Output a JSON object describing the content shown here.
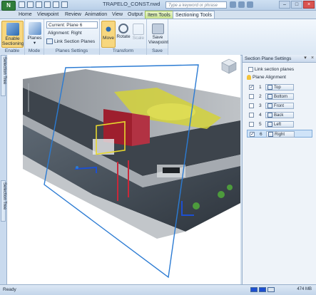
{
  "title_bar": {
    "app_button": "N",
    "document_title": "TRAPELO_CONST.nwd",
    "search_placeholder": "Type a keyword or phrase"
  },
  "tabs": [
    "Home",
    "Viewpoint",
    "Review",
    "Animation",
    "View",
    "Output",
    "Item Tools",
    "Sectioning Tools"
  ],
  "ribbon": {
    "enable": {
      "button": "Enable Sectioning",
      "group": "Enable"
    },
    "mode": {
      "button": "Planes",
      "group": "Mode"
    },
    "planes_settings": {
      "current": "Current: Plane 6",
      "alignment": "Alignment: Right",
      "link": "Link Section Planes",
      "group": "Planes Settings"
    },
    "transform": {
      "move": "Move",
      "rotate": "Rotate",
      "scale": "Scale",
      "group": "Transform"
    },
    "save": {
      "button": "Save Viewpoint",
      "group": "Save"
    }
  },
  "left_strip": {
    "top_tab": "Selection Tree",
    "bottom_tab": "Selection Tree"
  },
  "panel": {
    "title": "Section Plane Settings",
    "link_label": "Link section planes",
    "alignment_label": "Plane Alignment",
    "planes": [
      {
        "num": "1",
        "label": "Top",
        "enabled": true
      },
      {
        "num": "2",
        "label": "Bottom",
        "enabled": false
      },
      {
        "num": "3",
        "label": "Front",
        "enabled": false
      },
      {
        "num": "4",
        "label": "Back",
        "enabled": false
      },
      {
        "num": "5",
        "label": "Left",
        "enabled": false
      },
      {
        "num": "6",
        "label": "Right",
        "enabled": true
      }
    ]
  },
  "status": {
    "text": "Ready",
    "memory": "474 MB"
  },
  "colors": {
    "accent": "#2b7bd3",
    "ribbon_context": "#c9e38f",
    "selection": "#f7d77f"
  }
}
